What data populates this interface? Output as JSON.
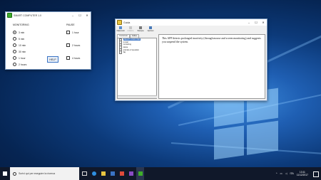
{
  "monitor_window": {
    "title": "SMART COMPUTER 1.0",
    "monitoring_header": "MONITORING",
    "pause_header": "PAUSE",
    "monitoring_options": [
      {
        "label": "3 min",
        "selected": true
      },
      {
        "label": "5 min",
        "selected": false
      },
      {
        "label": "10 min",
        "selected": false
      },
      {
        "label": "30 min",
        "selected": false
      },
      {
        "label": "1 hour",
        "selected": false
      },
      {
        "label": "2 hours",
        "selected": false
      }
    ],
    "pause_options": [
      {
        "label": "1 hour"
      },
      {
        "label": "2 hours"
      },
      {
        "label": "4 hours"
      }
    ],
    "help_label": "HELP"
  },
  "guida_window": {
    "title": "Guida",
    "toolbar": [
      "Nascondi",
      "Indietro",
      "Stampa",
      "Opzioni"
    ],
    "tabs": [
      "Contenuto",
      "Indice"
    ],
    "tree_items": [
      {
        "label": "SMART COMPUTER",
        "selected": true
      },
      {
        "label": "to start",
        "selected": false
      },
      {
        "label": "monitoring",
        "selected": false
      },
      {
        "label": "pause",
        "selected": false
      },
      {
        "label": "principle of operation",
        "selected": false
      },
      {
        "label": "faq",
        "selected": false
      }
    ],
    "content_text": "This APP detects prolonged inactivity (through mouse and screen monitoring) and suggests you suspend the system."
  },
  "taskbar": {
    "search_placeholder": "Scrivi qui per eseguire la ricerca",
    "time": "13:11",
    "date": "11/12/2017",
    "language": "ITA"
  },
  "colors": {
    "accent": "#3a73c4",
    "app_icon": "#3fae2a",
    "taskbar": "#10182a"
  }
}
